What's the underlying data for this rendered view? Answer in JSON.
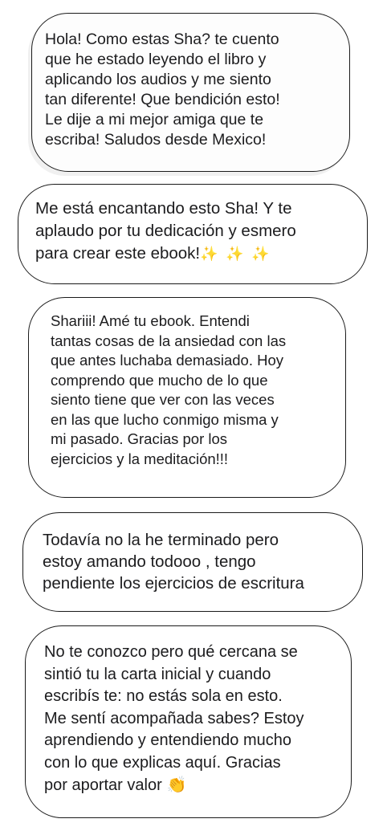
{
  "messages": [
    {
      "text": "Hola! Como estas Sha? te cuento\nque he estado leyendo el libro y\naplicando los audios y me siento\ntan diferente! Que bendición esto!\nLe dije a mi mejor amiga que te\nescriba! Saludos desde Mexico!"
    },
    {
      "text": "Me está encantando esto Sha! Y te\naplaudo por tu dedicación y esmero\npara crear este ebook!",
      "emoji": "✨ ✨ ✨",
      "emoji_icon": "sparkles-icon"
    },
    {
      "text": "Shariii! Amé tu ebook. Entendi\ntantas cosas de la ansiedad con las\nque antes luchaba demasiado. Hoy\ncomprendo que mucho de lo que\nsiento tiene que ver con las veces\nen las que lucho conmigo misma y\nmi pasado. Gracias por los\nejercicios y la meditación!!!"
    },
    {
      "text": "Todavía no la he terminado pero\nestoy amando todooo , tengo\npendiente los ejercicios de escritura"
    },
    {
      "text": "No te conozco pero qué cercana se\nsintió tu la carta inicial y cuando\nescribís te: no estás sola en esto.\nMe sentí acompañada sabes? Estoy\naprendiendo y entendiendo mucho\ncon lo que explicas aquí. Gracias\npor aportar valor",
      "emoji": "👏",
      "emoji_icon": "clapping-hands-icon"
    }
  ],
  "colors": {
    "bubble_border": "#1a1a1a",
    "text": "#1c1c1e",
    "sparkle": "#f3c63a"
  }
}
